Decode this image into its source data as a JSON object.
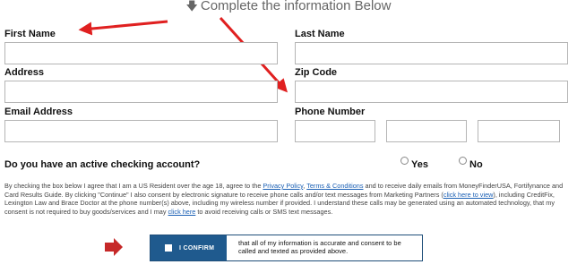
{
  "header": {
    "title": "Complete the information Below",
    "arrow_glyph": "🡇"
  },
  "form": {
    "first_name_label": "First Name",
    "last_name_label": "Last Name",
    "address_label": "Address",
    "zip_label": "Zip Code",
    "email_label": "Email Address",
    "phone_label": "Phone Number",
    "first_name_value": "",
    "last_name_value": "",
    "address_value": "",
    "zip_value": "",
    "email_value": "",
    "phone_area_value": "",
    "phone_prefix_value": "",
    "phone_line_value": ""
  },
  "checking": {
    "question": "Do you have an active checking account?",
    "yes_label": "Yes",
    "no_label": "No"
  },
  "disclaimer": {
    "part1": "By checking the box below I agree that I am a US Resident over the age 18, agree to the ",
    "privacy_link": "Privacy Policy",
    "sep1": ", ",
    "terms_link": "Terms & Conditions",
    "part2": " and to receive daily emails from MoneyFinderUSA, Fortifynance and Card Results Guide. By clicking \"Continue\" I also consent by electronic signature to receive phone calls and/or text messages from Marketing Partners (",
    "view_link": "click here to view",
    "part3": "), including CreditFix, Lexington Law and Brace Doctor at the phone number(s) above, including my wireless number if provided. I understand these calls may be generated using an automated technology, that my consent is not required to buy goods/services and I may ",
    "avoid_link": "click here",
    "part4": " to avoid receiving calls or SMS text messages."
  },
  "confirm": {
    "button_label": "I CONFIRM",
    "text": "that all of my information is accurate and consent to be called and texted as provided above."
  },
  "colors": {
    "annotation_arrow": "#e02020",
    "confirm_button": "#1f5a8e",
    "link": "#1a5fb4"
  }
}
